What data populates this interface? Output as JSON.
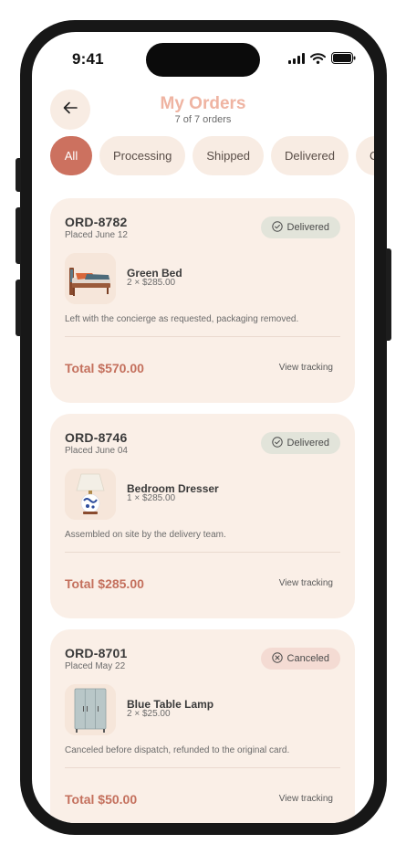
{
  "status_bar": {
    "time": "9:41",
    "icons": [
      "signal-icon",
      "wifi-icon",
      "battery-icon"
    ]
  },
  "header": {
    "title": "My Orders",
    "subtitle": "7 of 7 orders",
    "back_icon": "arrow-left-icon"
  },
  "tabs": [
    {
      "label": "All",
      "active": true
    },
    {
      "label": "Processing",
      "active": false
    },
    {
      "label": "Shipped",
      "active": false
    },
    {
      "label": "Delivered",
      "active": false
    },
    {
      "label": "Canceled",
      "active": false
    }
  ],
  "orders": [
    {
      "id": "ORD-8782",
      "placed": "Placed June 12",
      "status": "Delivered",
      "status_icon": "check-circle-icon",
      "item_name": "Green Bed",
      "item_qty": "2 × $285.00",
      "thumb_icon": "bed-image",
      "note": "Left with the concierge as requested, packaging removed.",
      "total": "Total $570.00",
      "tracking_label": "View tracking"
    },
    {
      "id": "ORD-8746",
      "placed": "Placed June 04",
      "status": "Delivered",
      "status_icon": "check-circle-icon",
      "item_name": "Bedroom Dresser",
      "item_qty": "1 × $285.00",
      "thumb_icon": "lamp-image",
      "note": "Assembled on site by the delivery team.",
      "total": "Total $285.00",
      "tracking_label": "View tracking"
    },
    {
      "id": "ORD-8701",
      "placed": "Placed May 22",
      "status": "Canceled",
      "status_icon": "x-circle-icon",
      "item_name": "Blue Table Lamp",
      "item_qty": "2 × $25.00",
      "thumb_icon": "wardrobe-image",
      "note": "Canceled before dispatch, refunded to the original card.",
      "total": "Total $50.00",
      "tracking_label": "View tracking"
    }
  ],
  "colors": {
    "accent": "#cc715f",
    "title": "#efb4a2",
    "card_bg": "#faefe7",
    "delivered_badge": "#e2e4da",
    "canceled_badge": "#f4dbd3"
  }
}
